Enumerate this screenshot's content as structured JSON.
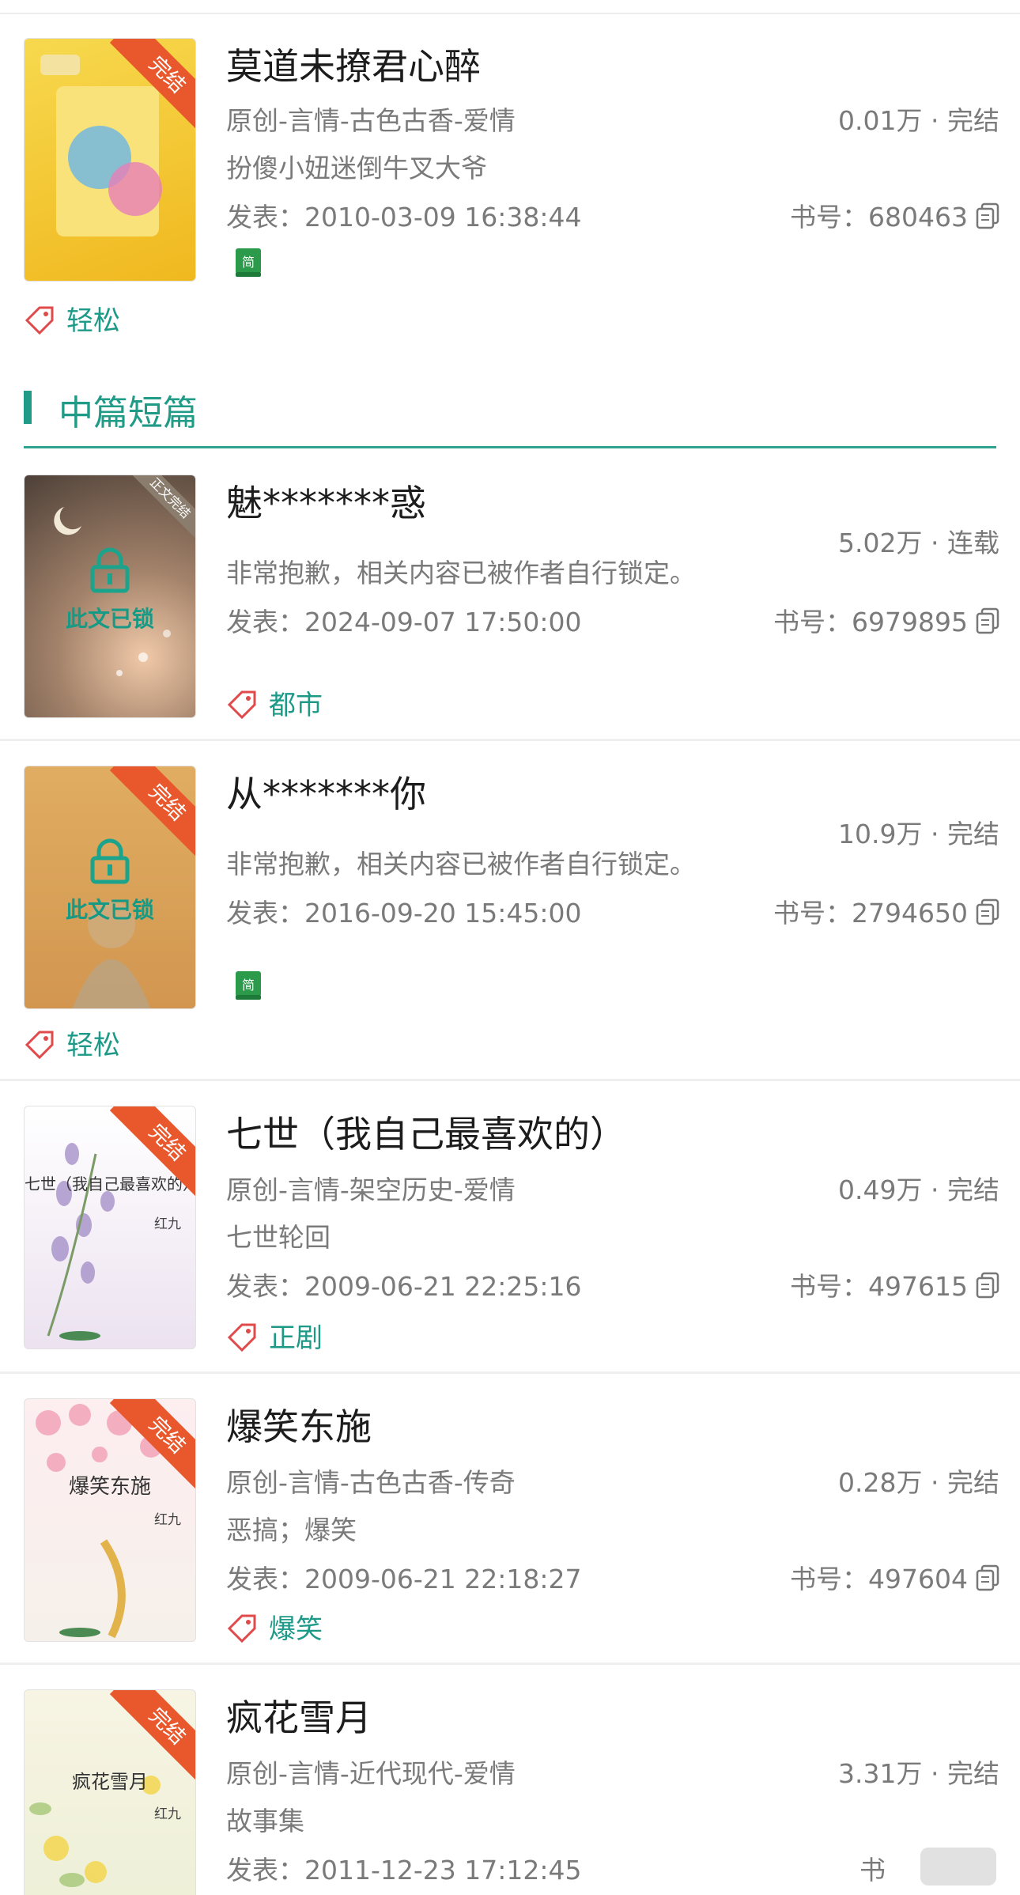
{
  "section": {
    "title": "中篇短篇"
  },
  "books": [
    {
      "title": "莫道未撩君心醉",
      "category": "原创-言情-古色古香-爱情",
      "summary": "扮傻小妞迷倒牛叉大爷",
      "published": "发表：2010-03-09 16:38:44",
      "stats": "0.01万 · 完结",
      "book_id": "书号：680463",
      "badge": "完结",
      "simplified": "简",
      "tag": "轻松",
      "cover_color": "#f3c531",
      "cover_text": ""
    },
    {
      "title": "魅*******惑",
      "category": "",
      "summary": "非常抱歉，相关内容已被作者自行锁定。",
      "published": "发表：2024-09-07 17:50:00",
      "stats": "5.02万 · 连载",
      "book_id": "书号：6979895",
      "badge": "正文完结",
      "lock_label": "此文已锁",
      "tag": "都市",
      "cover_color": "#6d5a4a"
    },
    {
      "title": "从*******你",
      "category": "",
      "summary": "非常抱歉，相关内容已被作者自行锁定。",
      "published": "发表：2016-09-20 15:45:00",
      "stats": "10.9万 · 完结",
      "book_id": "书号：2794650",
      "badge": "完结",
      "lock_label": "此文已锁",
      "simplified": "简",
      "tag": "轻松",
      "cover_color": "#d9a25a"
    },
    {
      "title": "七世（我自己最喜欢的）",
      "category": "原创-言情-架空历史-爱情",
      "summary": "七世轮回",
      "published": "发表：2009-06-21 22:25:16",
      "stats": "0.49万 · 完结",
      "book_id": "书号：497615",
      "badge": "完结",
      "cover_title": "七世（我自己最喜欢的）",
      "cover_author": "红九",
      "tag": "正剧",
      "cover_color": "#efe6f2"
    },
    {
      "title": "爆笑东施",
      "category": "原创-言情-古色古香-传奇",
      "summary": "恶搞；爆笑",
      "published": "发表：2009-06-21 22:18:27",
      "stats": "0.28万 · 完结",
      "book_id": "书号：497604",
      "badge": "完结",
      "cover_title": "爆笑东施",
      "cover_author": "红九",
      "tag": "爆笑",
      "cover_color": "#fbeaea"
    },
    {
      "title": "疯花雪月",
      "category": "原创-言情-近代现代-爱情",
      "summary": "故事集",
      "published": "发表：2011-12-23 17:12:45",
      "stats": "3.31万 · 完结",
      "book_id": "书",
      "badge": "完结",
      "cover_title": "疯花雪月",
      "cover_author": "红九",
      "cover_color": "#f4f1de"
    }
  ],
  "colors": {
    "accent": "#1f9b87",
    "badge": "#e9572c",
    "muted": "#7a7a7a"
  },
  "icons": {
    "copy": "copy-icon",
    "tag": "tag-icon",
    "lock": "lock-icon",
    "simplified": "book-simplified-icon"
  }
}
